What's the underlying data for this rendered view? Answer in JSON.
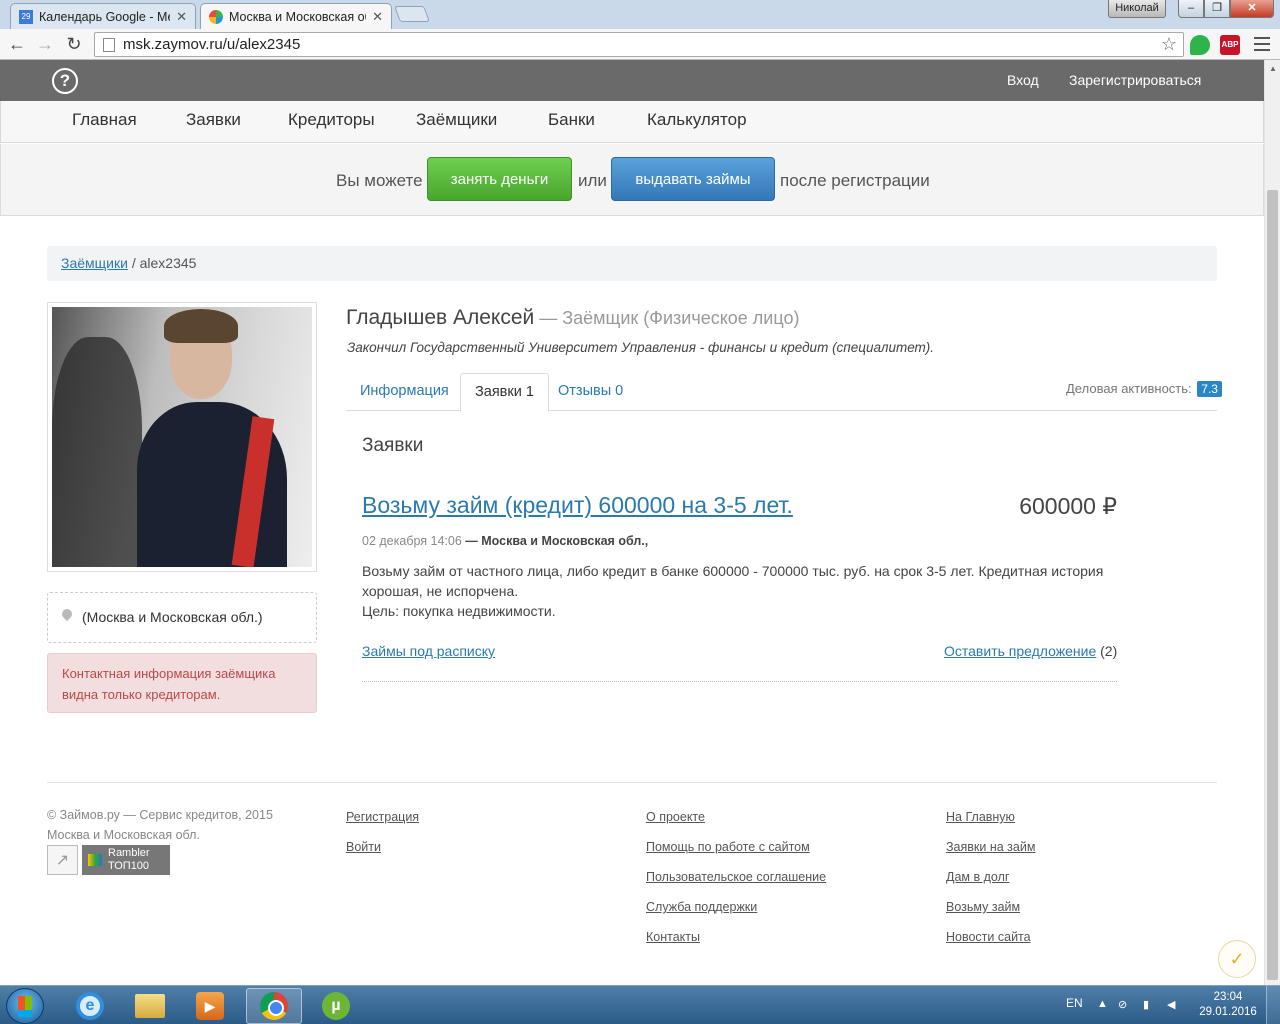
{
  "browser": {
    "tabs": [
      {
        "title": "Календарь Google - Мес",
        "favicon_text": "29",
        "favicon_color": "#3a7bd5"
      },
      {
        "title": "Москва и Московская об",
        "favicon_color": "#39b54a"
      }
    ],
    "user": "Николай",
    "url": "msk.zaymov.ru/u/alex2345",
    "abp_label": "ABP"
  },
  "header": {
    "login": "Вход",
    "register": "Зарегистрироваться"
  },
  "nav": {
    "items": [
      "Главная",
      "Заявки",
      "Кредиторы",
      "Заёмщики",
      "Банки",
      "Калькулятор"
    ]
  },
  "cta": {
    "prefix": "Вы можете",
    "borrow_button": "занять деньги",
    "or": "или",
    "lend_button": "выдавать займы",
    "suffix": "после регистрации"
  },
  "breadcrumb": {
    "parent": "Заёмщики",
    "separator": " / ",
    "current": "alex2345"
  },
  "sidebar": {
    "location": "(Москва и Московская обл.)",
    "contact_notice": "Контактная информация заёмщика видна только кредиторам."
  },
  "profile": {
    "name": "Гладышев Алексей",
    "role": " — Заёмщик (Физическое лицо)",
    "education": "Закончил Государственный Университет Управления - финансы и кредит (специалитет).",
    "tabs": [
      "Информация",
      "Заявки 1",
      "Отзывы 0"
    ],
    "activity_label": "Деловая активность:",
    "activity_value": "7.3"
  },
  "requests": {
    "section_title": "Заявки",
    "item": {
      "title": "Возьму займ (кредит) 600000 на 3-5 лет.",
      "amount": "600000 ₽",
      "date": "02 декабря 14:06",
      "location": " — Москва и Московская обл.,",
      "description_line1": "Возьму займ от частного лица, либо кредит в банке 600000 - 700000 тыс. руб. на срок 3-5 лет. Кредитная история хорошая, не испорчена.",
      "description_line2": "Цель: покупка недвижимости.",
      "link_left": "Займы под расписку",
      "link_right": "Оставить предложение",
      "offers_count": " (2)"
    }
  },
  "footer": {
    "copyright_line1": "© Займов.ру — Сервис кредитов, 2015",
    "copyright_line2": "Москва и Московская обл.",
    "rambler_line1": "Rambler",
    "rambler_line2": "ТОП100",
    "col1": [
      "Регистрация",
      "Войти"
    ],
    "col2": [
      "О проекте",
      "Помощь по работе с сайтом",
      "Пользовательское соглашение",
      "Служба поддержки",
      "Контакты"
    ],
    "col3": [
      "На Главную",
      "Заявки на займ",
      "Дам в долг",
      "Возьму займ",
      "Новости сайта"
    ]
  },
  "taskbar": {
    "lang": "EN",
    "time": "23:04",
    "date": "29.01.2016"
  },
  "colors": {
    "accent_link": "#2a7ab0",
    "green_button": "#48a62d",
    "blue_button": "#3478b8",
    "header_bg": "#6a6a6a",
    "alert_bg": "#f2dede",
    "badge": "#2a86c6"
  }
}
